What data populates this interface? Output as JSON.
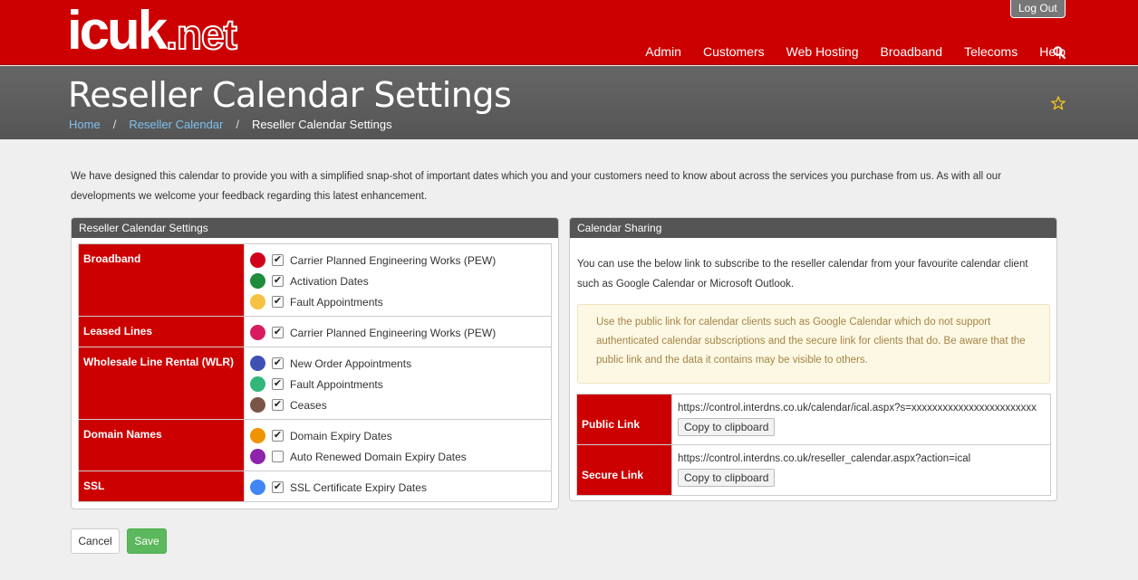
{
  "header": {
    "logo_main": "icuk",
    "logo_suffix": ".net",
    "logout_label": "Log Out",
    "nav": [
      "Admin",
      "Customers",
      "Web Hosting",
      "Broadband",
      "Telecoms",
      "Help"
    ]
  },
  "title_band": {
    "title": "Reseller Calendar Settings",
    "breadcrumb": [
      "Home",
      "Reseller Calendar",
      "Reseller Calendar Settings"
    ]
  },
  "intro": "We have designed this calendar to provide you with a simplified snap-shot of important dates which you and your customers need to know about across the services you purchase from us. As with all our developments we welcome your feedback regarding this latest enhancement.",
  "settings_panel": {
    "title": "Reseller Calendar Settings",
    "categories": [
      {
        "name": "Broadband",
        "options": [
          {
            "label": "Carrier Planned Engineering Works (PEW)",
            "color": "#d0021b",
            "checked": true
          },
          {
            "label": "Activation Dates",
            "color": "#1e8c3a",
            "checked": true
          },
          {
            "label": "Fault Appointments",
            "color": "#f5c242",
            "checked": true
          }
        ]
      },
      {
        "name": "Leased Lines",
        "options": [
          {
            "label": "Carrier Planned Engineering Works (PEW)",
            "color": "#d81b60",
            "checked": true
          }
        ]
      },
      {
        "name": "Wholesale Line Rental (WLR)",
        "options": [
          {
            "label": "New Order Appointments",
            "color": "#3f51b5",
            "checked": true
          },
          {
            "label": "Fault Appointments",
            "color": "#33b679",
            "checked": true
          },
          {
            "label": "Ceases",
            "color": "#795548",
            "checked": true
          }
        ]
      },
      {
        "name": "Domain Names",
        "options": [
          {
            "label": "Domain Expiry Dates",
            "color": "#f09300",
            "checked": true
          },
          {
            "label": "Auto Renewed Domain Expiry Dates",
            "color": "#8e24aa",
            "checked": false
          }
        ]
      },
      {
        "name": "SSL",
        "options": [
          {
            "label": "SSL Certificate Expiry Dates",
            "color": "#4285f4",
            "checked": true
          }
        ]
      }
    ]
  },
  "sharing_panel": {
    "title": "Calendar Sharing",
    "text": "You can use the below link to subscribe to the reseller calendar from your favourite calendar client such as Google Calendar or Microsoft Outlook.",
    "alert": "Use the public link for calendar clients such as Google Calendar which do not support authenticated calendar subscriptions and the secure link for clients that do. Be aware that the public link and the data it contains may be visible to others.",
    "links": [
      {
        "label": "Public Link",
        "url": "https://control.interdns.co.uk/calendar/ical.aspx?s=xxxxxxxxxxxxxxxxxxxxxxxx",
        "copy_label": "Copy to clipboard"
      },
      {
        "label": "Secure Link",
        "url": "https://control.interdns.co.uk/reseller_calendar.aspx?action=ical",
        "copy_label": "Copy to clipboard"
      }
    ]
  },
  "actions": {
    "cancel_label": "Cancel",
    "save_label": "Save"
  },
  "colors": {
    "brand_red": "#cc0000",
    "title_band": "#5e5e5e",
    "save_green": "#5cb85c"
  }
}
